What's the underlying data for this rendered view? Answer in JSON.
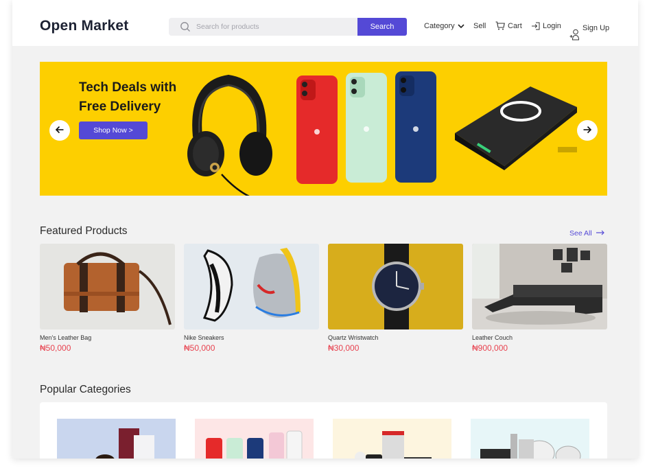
{
  "header": {
    "logo": "Open Market",
    "search_placeholder": "Search for products",
    "search_button": "Search",
    "nav": {
      "category": "Category",
      "sell": "Sell",
      "cart": "Cart",
      "login": "Login",
      "signup": "Sign Up"
    }
  },
  "banner": {
    "title": "Tech Deals with Free Delivery",
    "cta": "Shop Now >",
    "bg_color": "#fdcf00"
  },
  "featured": {
    "title": "Featured Products",
    "see_all": "See All",
    "products": [
      {
        "name": "Men's Leather Bag",
        "price": "₦50,000"
      },
      {
        "name": "Nike Sneakers",
        "price": "₦50,000"
      },
      {
        "name": "Quartz Wristwatch",
        "price": "₦30,000"
      },
      {
        "name": "Leather Couch",
        "price": "₦900,000"
      }
    ]
  },
  "popular": {
    "title": "Popular Categories"
  },
  "colors": {
    "accent": "#5449d6",
    "price": "#e8424f",
    "banner": "#fdcf00"
  }
}
